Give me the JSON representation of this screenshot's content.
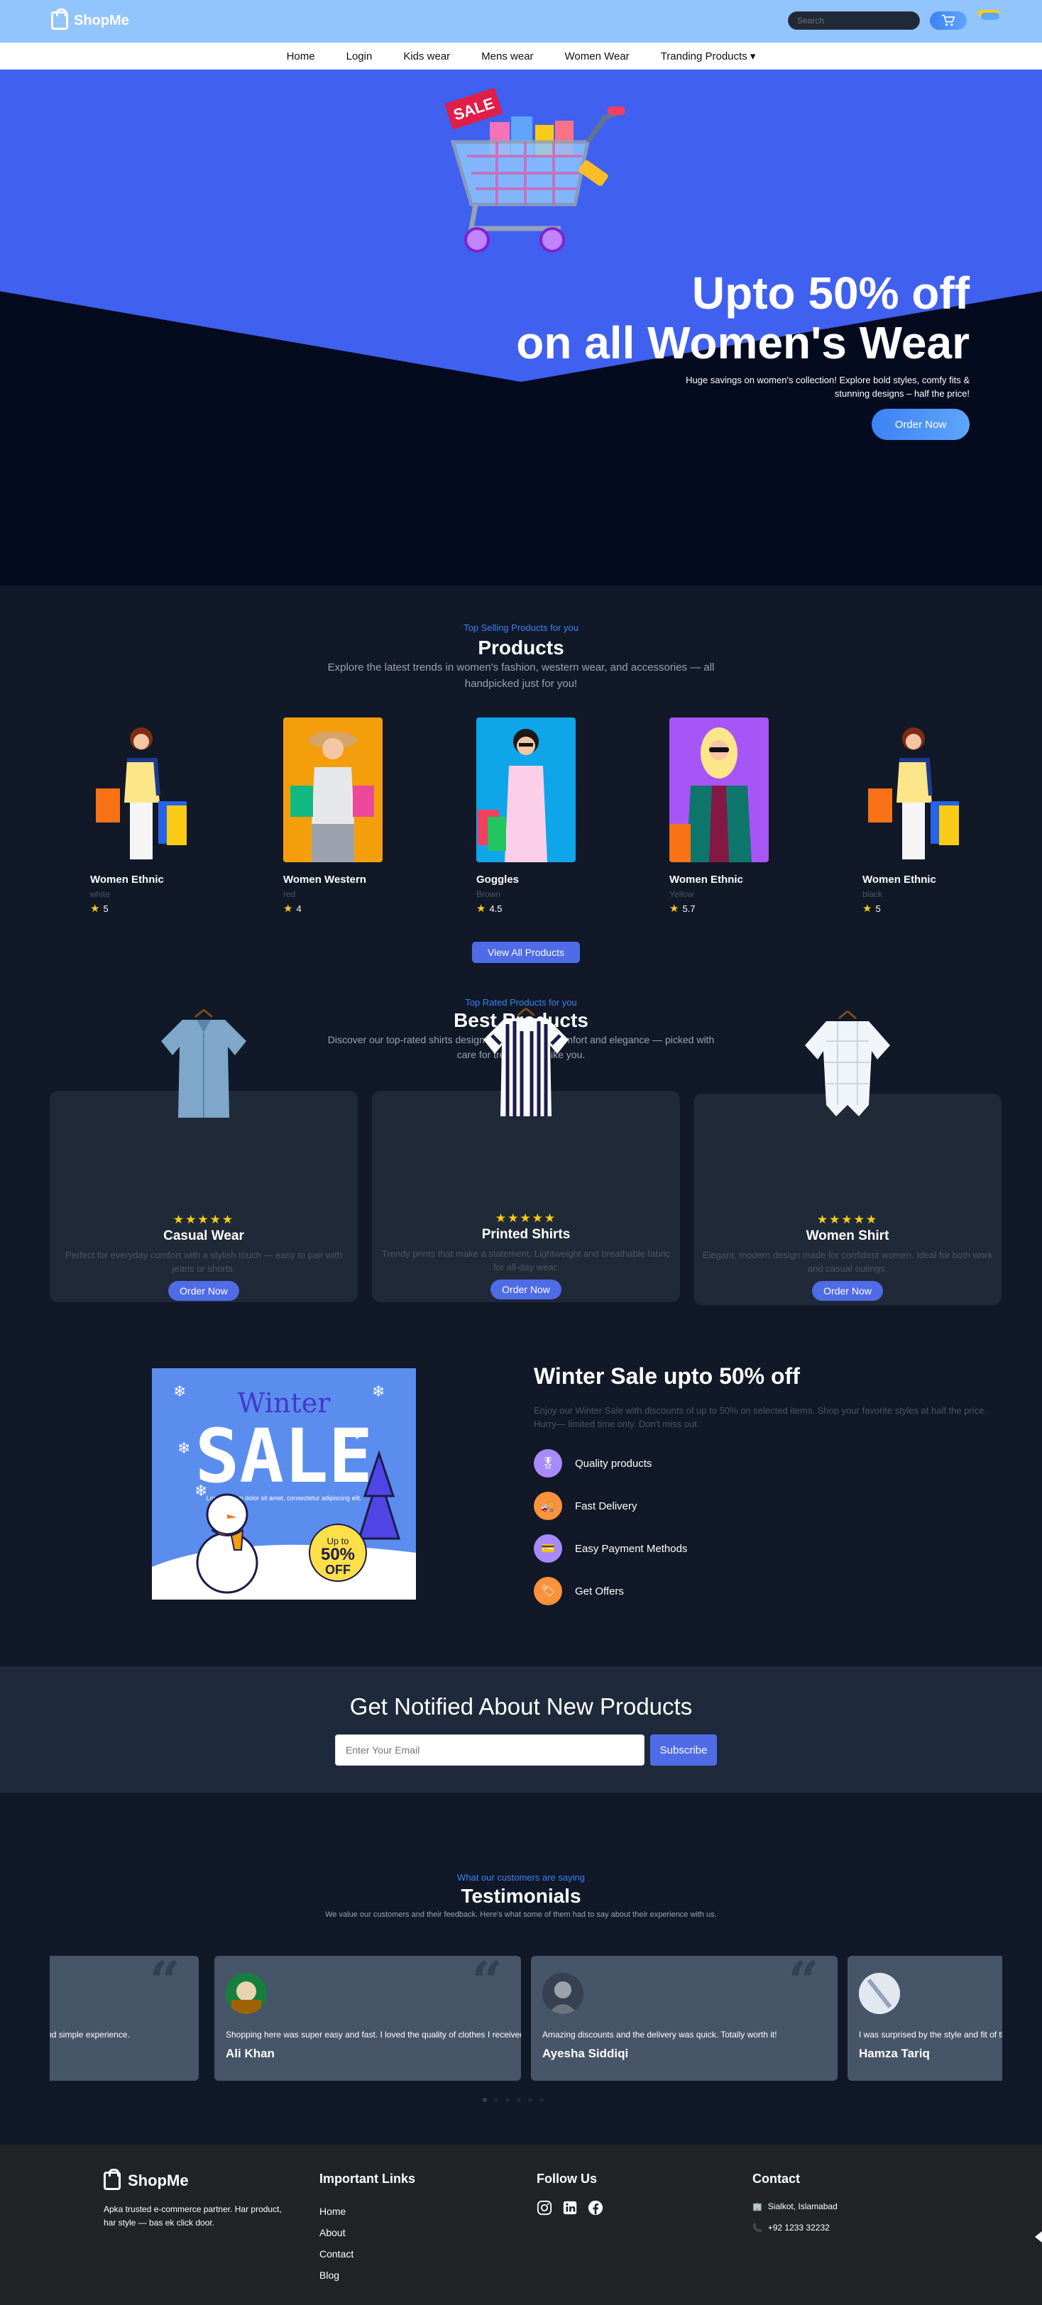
{
  "header": {
    "brand": "ShopMe",
    "search_placeholder": "Search"
  },
  "nav": {
    "items": [
      "Home",
      "Login",
      "Kids wear",
      "Mens wear",
      "Women Wear",
      "Tranding Products"
    ]
  },
  "hero": {
    "sale_tag": "SALE",
    "title_line1": "Upto 50% off",
    "title_line2": "on all Women's Wear",
    "subtitle": "Huge savings on women's collection! Explore bold styles, comfy fits & stunning designs – half the price!",
    "button": "Order Now"
  },
  "products": {
    "kicker": "Top Selling Products for you",
    "title": "Products",
    "description": "Explore the latest trends in women's fashion, western wear, and accessories — all handpicked just for you!",
    "items": [
      {
        "name": "Women Ethnic",
        "color": "white",
        "rating": "5",
        "bg": "#111827"
      },
      {
        "name": "Women Western",
        "color": "red",
        "rating": "4",
        "bg": "#f59e0b"
      },
      {
        "name": "Goggles",
        "color": "Brown",
        "rating": "4.5",
        "bg": "#0ea5e9"
      },
      {
        "name": "Women Ethnic",
        "color": "Yellow",
        "rating": "5.7",
        "bg": "#a855f7"
      },
      {
        "name": "Women Ethnic",
        "color": "black",
        "rating": "5",
        "bg": "#111827"
      }
    ],
    "view_all": "View All Products"
  },
  "best": {
    "kicker": "Top Rated Products for you",
    "title": "Best Products",
    "description": "Discover our top-rated shirts designed to offer both comfort and elegance — picked with care for trendsetters like you.",
    "items": [
      {
        "stars": "★★★★★",
        "name": "Casual Wear",
        "desc": "Perfect for everyday comfort with a stylish touch — easy to pair with jeans or shorts.",
        "button": "Order Now"
      },
      {
        "stars": "★★★★★",
        "name": "Printed Shirts",
        "desc": "Trendy prints that make a statement. Lightweight and breathable fabric for all-day wear.",
        "button": "Order Now"
      },
      {
        "stars": "★★★★★",
        "name": "Women Shirt",
        "desc": "Elegant, modern design made for confident women. Ideal for both work and casual outings.",
        "button": "Order Now"
      }
    ]
  },
  "winter": {
    "poster_word1": "Winter",
    "poster_word2": "SALE",
    "poster_small": "Lorem ipsum dolor sit amet, consectetur adipiscing elit.",
    "badge_top": "Up to",
    "badge_value": "50%",
    "badge_bottom": "OFF",
    "title": "Winter Sale upto 50% off",
    "description": "Enjoy our Winter Sale with discounts of up to 50% on selected items. Shop your favorite styles at half the price. Hurry— limited time only. Don't miss out.",
    "features": [
      {
        "label": "Quality products",
        "color": "#a78bfa",
        "icon": "🎖"
      },
      {
        "label": "Fast Delivery",
        "color": "#fb923c",
        "icon": "🚚"
      },
      {
        "label": "Easy Payment Methods",
        "color": "#a78bfa",
        "icon": "💳"
      },
      {
        "label": "Get Offers",
        "color": "#fb923c",
        "icon": "🏷"
      }
    ]
  },
  "newsletter": {
    "title": "Get Notified About New Products",
    "placeholder": "Enter Your Email",
    "button": "Subscribe"
  },
  "testimonials": {
    "kicker": "What our customers are saying",
    "title": "Testimonials",
    "description": "We value our customers and their feedback. Here's what some of them had to say about their experience with us.",
    "items": [
      {
        "text": "Great shopping experience. Smooth and simple experience.",
        "name": ""
      },
      {
        "text": "Shopping here was super easy and fast. I loved the quality of clothes I received!",
        "name": "Ali Khan"
      },
      {
        "text": "Amazing discounts and the delivery was quick. Totally worth it!",
        "name": "Ayesha Siddiqi"
      },
      {
        "text": "I was surprised by the style and fit of the clothes.",
        "name": "Hamza Tariq"
      }
    ]
  },
  "footer": {
    "brand": "ShopMe",
    "about": "Apka trusted e-commerce partner. Har product, har style — bas ek click door.",
    "links_title": "Important Links",
    "links": [
      "Home",
      "About",
      "Contact",
      "Blog"
    ],
    "follow_title": "Follow Us",
    "contact_title": "Contact",
    "address": "Sialkot, Islamabad",
    "phone": "+92 1233 32232"
  }
}
